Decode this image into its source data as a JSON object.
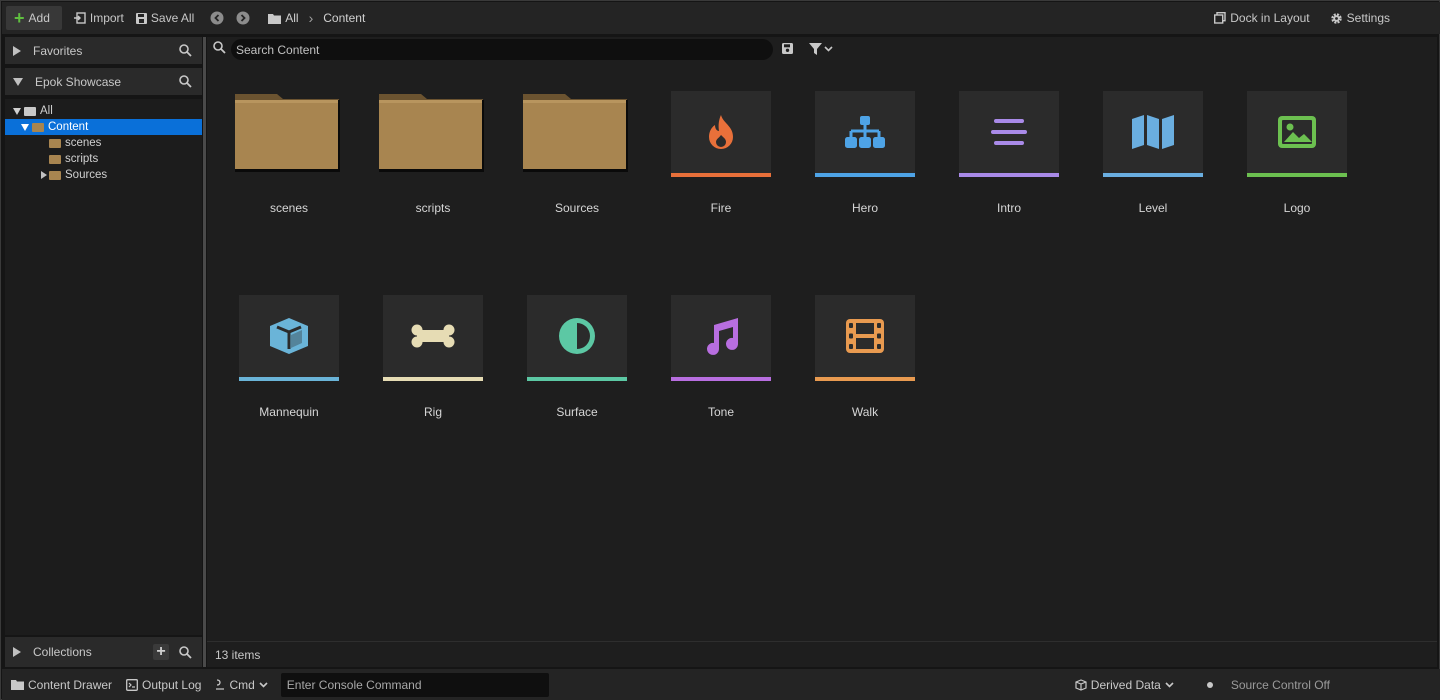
{
  "toolbar": {
    "add_label": "Add",
    "import_label": "Import",
    "save_all_label": "Save All",
    "breadcrumb": [
      "All",
      "Content"
    ],
    "dock_label": "Dock in Layout",
    "settings_label": "Settings"
  },
  "sidebar": {
    "favorites_label": "Favorites",
    "project_label": "Epok Showcase",
    "tree": [
      {
        "label": "All",
        "depth": 0,
        "expanded": true,
        "selected": false
      },
      {
        "label": "Content",
        "depth": 1,
        "expanded": true,
        "selected": true
      },
      {
        "label": "scenes",
        "depth": 2,
        "expanded": false,
        "selected": false
      },
      {
        "label": "scripts",
        "depth": 2,
        "expanded": false,
        "selected": false
      },
      {
        "label": "Sources",
        "depth": 2,
        "expanded": false,
        "selected": false,
        "has_children": true
      }
    ],
    "collections_label": "Collections"
  },
  "content": {
    "search_placeholder": "Search Content",
    "items": [
      {
        "label": "scenes",
        "kind": "folder"
      },
      {
        "label": "scripts",
        "kind": "folder"
      },
      {
        "label": "Sources",
        "kind": "folder"
      },
      {
        "label": "Fire",
        "kind": "asset",
        "icon": "fire-icon",
        "color": "#e8703a"
      },
      {
        "label": "Hero",
        "kind": "asset",
        "icon": "hierarchy-icon",
        "color": "#4ea3e6"
      },
      {
        "label": "Intro",
        "kind": "asset",
        "icon": "text-lines-icon",
        "color": "#a98ae8"
      },
      {
        "label": "Level",
        "kind": "asset",
        "icon": "map-icon",
        "color": "#6aaee0"
      },
      {
        "label": "Logo",
        "kind": "asset",
        "icon": "image-icon",
        "color": "#6cc050"
      },
      {
        "label": "Mannequin",
        "kind": "asset",
        "icon": "cube-icon",
        "color": "#6ab4d8"
      },
      {
        "label": "Rig",
        "kind": "asset",
        "icon": "bone-icon",
        "color": "#e6dcb4"
      },
      {
        "label": "Surface",
        "kind": "asset",
        "icon": "contrast-icon",
        "color": "#5cc8a4"
      },
      {
        "label": "Tone",
        "kind": "asset",
        "icon": "music-note-icon",
        "color": "#b86ee0"
      },
      {
        "label": "Walk",
        "kind": "asset",
        "icon": "film-icon",
        "color": "#e89a50"
      }
    ],
    "item_count": "13 items"
  },
  "bottom": {
    "content_drawer_label": "Content Drawer",
    "output_log_label": "Output Log",
    "cmd_label": "Cmd",
    "console_placeholder": "Enter Console Command",
    "derived_data_label": "Derived Data",
    "source_control_label": "Source Control Off"
  }
}
